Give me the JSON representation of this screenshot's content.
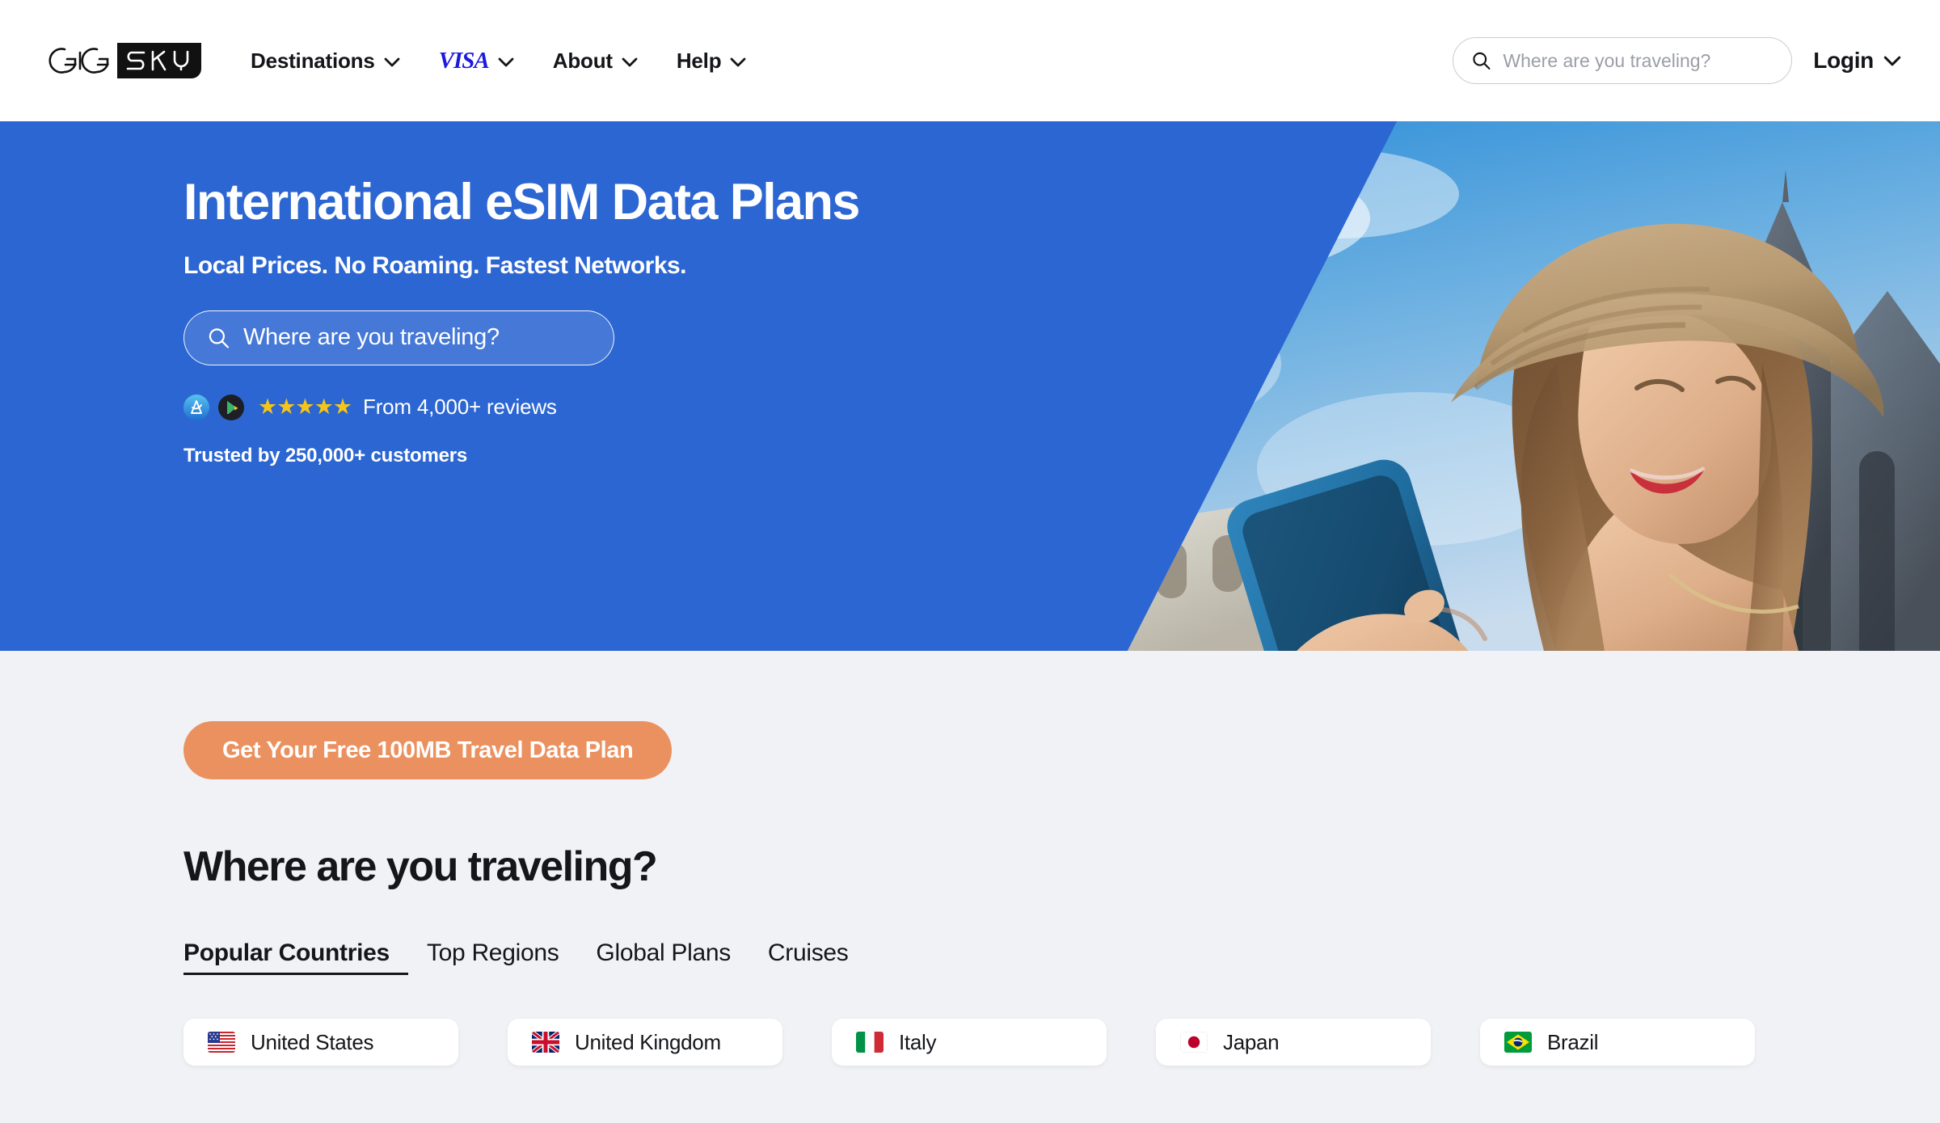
{
  "brand": {
    "name": "GigSky",
    "logo_text_left": "GIG",
    "logo_text_right": "SKY",
    "accent_blue": "#2C66D2",
    "accent_orange": "#EB9160",
    "visa_blue": "#1A1AE0",
    "page_background": "#F1F2F6"
  },
  "header": {
    "nav": [
      {
        "label": "Destinations",
        "icon": "chevron-down-icon",
        "type": "text"
      },
      {
        "label": "VISA",
        "icon": "chevron-down-icon",
        "type": "visa"
      },
      {
        "label": "About",
        "icon": "chevron-down-icon",
        "type": "text"
      },
      {
        "label": "Help",
        "icon": "chevron-down-icon",
        "type": "text"
      }
    ],
    "search": {
      "placeholder": "Where are you traveling?",
      "value": "",
      "icon": "search-icon"
    },
    "login": {
      "label": "Login",
      "icon": "chevron-down-icon"
    }
  },
  "hero": {
    "title": "International eSIM Data Plans",
    "subtitle": "Local Prices. No Roaming. Fastest Networks.",
    "search": {
      "placeholder": "Where are you traveling?",
      "value": "",
      "icon": "search-icon"
    },
    "reviews": {
      "app_store_icon": "app-store-icon",
      "google_play_icon": "google-play-icon",
      "stars": "★★★★★",
      "star_count": 5,
      "text": "From 4,000+ reviews"
    },
    "trusted": "Trusted by 250,000+ customers",
    "image_alt": "Woman in straw hat holding a blue phone in front of a cathedral"
  },
  "main": {
    "cta_label": "Get Your Free 100MB Travel Data Plan",
    "section_title": "Where are you traveling?",
    "tabs": [
      {
        "label": "Popular Countries",
        "active": true
      },
      {
        "label": "Top Regions",
        "active": false
      },
      {
        "label": "Global Plans",
        "active": false
      },
      {
        "label": "Cruises",
        "active": false
      }
    ],
    "countries": [
      {
        "label": "United States",
        "flag": "flag-us"
      },
      {
        "label": "United Kingdom",
        "flag": "flag-gb"
      },
      {
        "label": "Italy",
        "flag": "flag-it"
      },
      {
        "label": "Japan",
        "flag": "flag-jp"
      },
      {
        "label": "Brazil",
        "flag": "flag-br"
      }
    ]
  }
}
